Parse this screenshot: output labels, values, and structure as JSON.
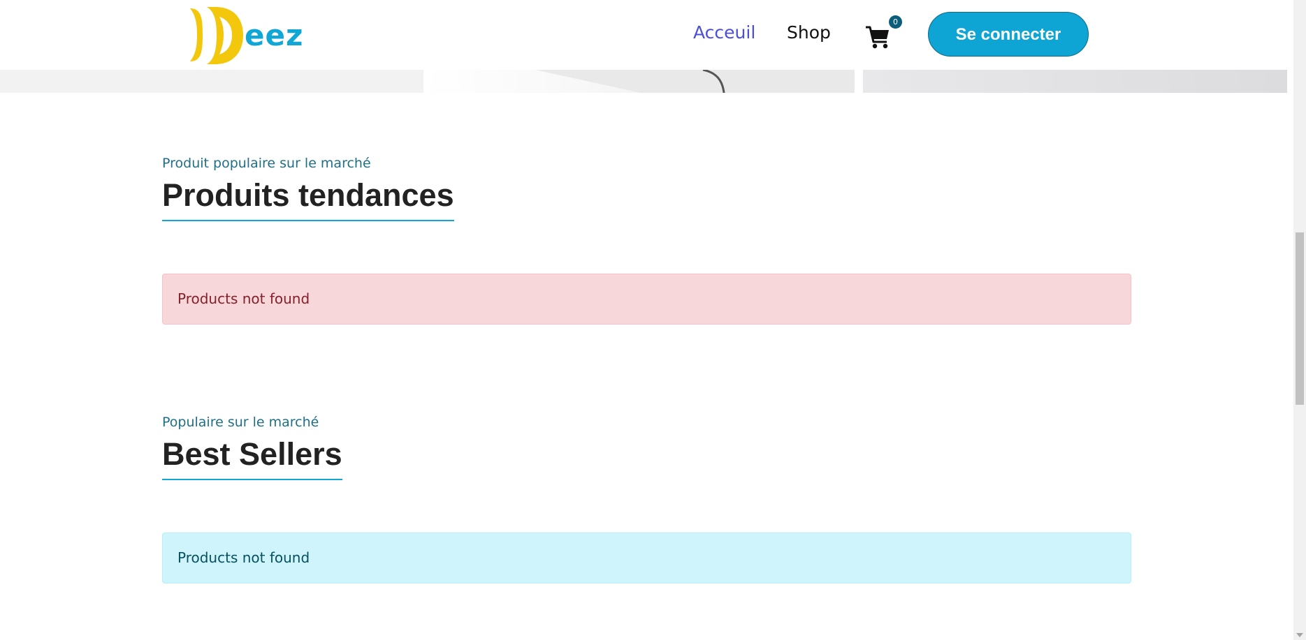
{
  "header": {
    "logo_text": "eez",
    "nav": [
      {
        "label": "Acceuil"
      },
      {
        "label": "Shop"
      }
    ],
    "cart_count": "0",
    "login_label": "Se connecter"
  },
  "sections": [
    {
      "eyebrow": "Produit populaire sur le marché",
      "title": "Produits tendances",
      "alert": "Products not found"
    },
    {
      "eyebrow": "Populaire sur le marché",
      "title": "Best Sellers",
      "alert": "Products not found"
    }
  ],
  "colors": {
    "accent": "#10a6d6",
    "logo_yellow": "#f2c70c",
    "nav_active": "#4b4fd9",
    "alert_danger_bg": "#f8d7da",
    "alert_info_bg": "#cff4fc"
  },
  "icons": [
    "cart-icon"
  ]
}
